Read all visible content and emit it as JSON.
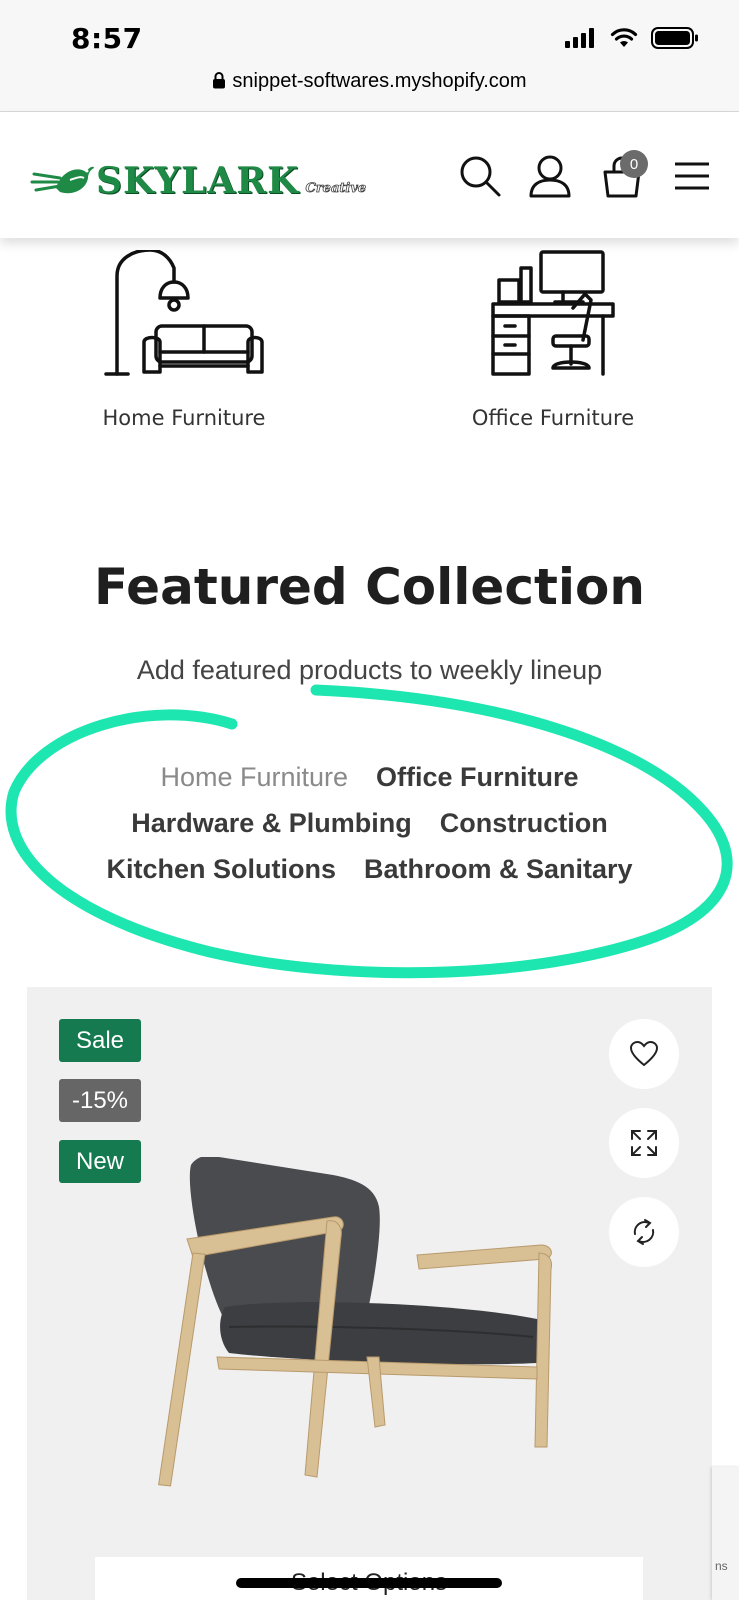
{
  "status_bar": {
    "time": "8:57"
  },
  "browser": {
    "url": "snippet-softwares.myshopify.com"
  },
  "header": {
    "logo_text": "SKYLARK",
    "logo_subtext": "Creative",
    "cart_count": "0",
    "icons": [
      "search-icon",
      "account-icon",
      "cart-icon",
      "menu-icon"
    ]
  },
  "categories": [
    {
      "label": "Home Furniture",
      "icon": "lamp-sofa-icon"
    },
    {
      "label": "Office Furniture",
      "icon": "office-desk-icon"
    }
  ],
  "featured": {
    "title": "Featured Collection",
    "subtitle": "Add featured products to weekly lineup",
    "tabs": [
      {
        "label": "Home Furniture",
        "active": true
      },
      {
        "label": "Office Furniture",
        "active": false
      },
      {
        "label": "Hardware & Plumbing",
        "active": false
      },
      {
        "label": "Construction",
        "active": false
      },
      {
        "label": "Kitchen Solutions",
        "active": false
      },
      {
        "label": "Bathroom & Sanitary",
        "active": false
      }
    ]
  },
  "product": {
    "badges": {
      "sale": "Sale",
      "discount": "-15%",
      "new": "New"
    },
    "action_icons": [
      "heart-icon",
      "expand-icon",
      "compare-icon"
    ],
    "select_label": "Select Options"
  },
  "recaptcha_text": "ns",
  "colors": {
    "brand_green": "#1e8a45",
    "badge_green": "#157a50",
    "badge_gray": "#666666",
    "annotation": "#1ee6b0",
    "card_bg": "#f0f0f0"
  }
}
